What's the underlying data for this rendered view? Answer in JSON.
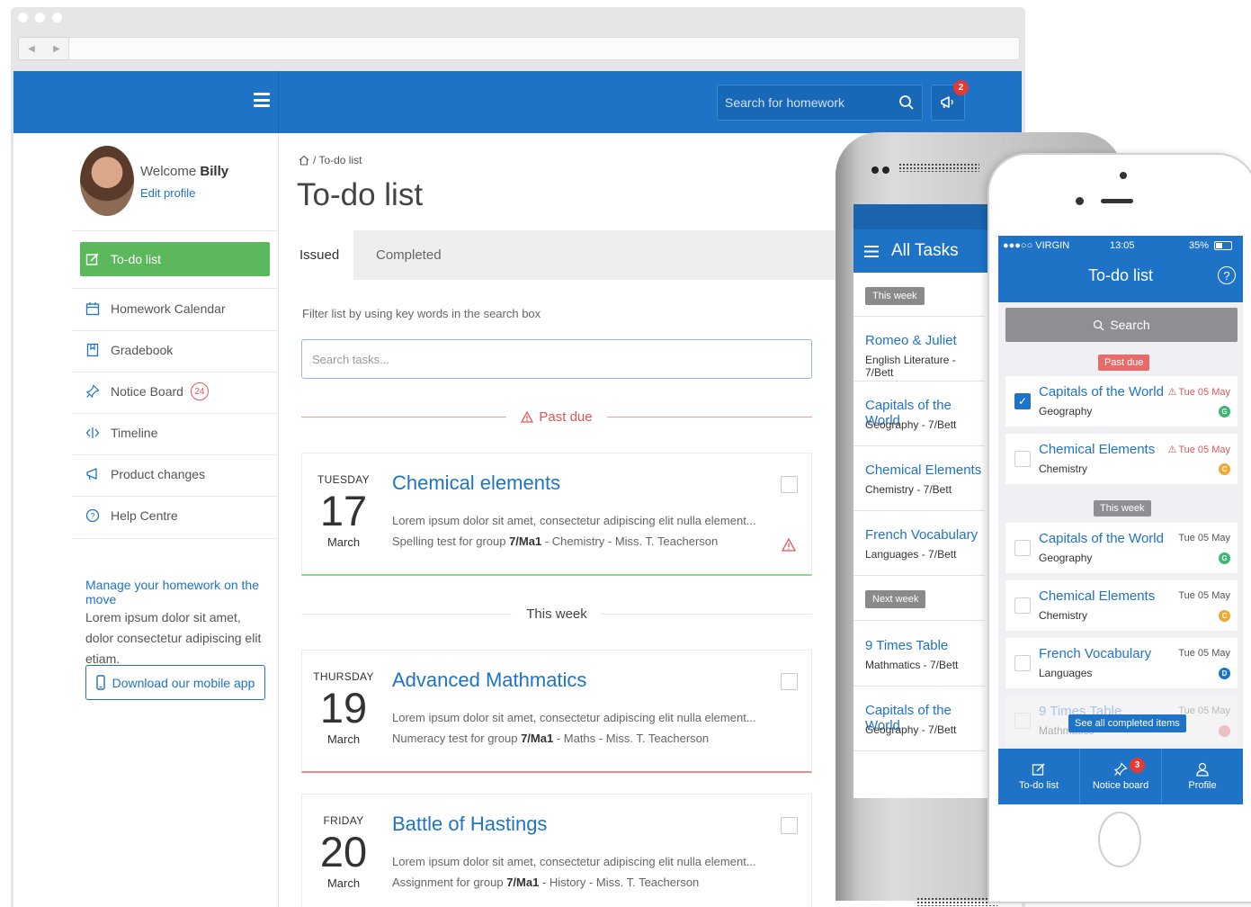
{
  "web": {
    "search_placeholder": "Search for homework",
    "notice_badge": "2",
    "user": {
      "welcome": "Welcome",
      "name": "Billy",
      "edit": "Edit profile"
    },
    "nav": [
      {
        "label": "To-do list"
      },
      {
        "label": "Homework Calendar"
      },
      {
        "label": "Gradebook"
      },
      {
        "label": "Notice Board",
        "count": "24"
      },
      {
        "label": "Timeline"
      },
      {
        "label": "Product changes"
      },
      {
        "label": "Help Centre"
      }
    ],
    "promo": {
      "title": "Manage your homework on the move",
      "text": "Lorem ipsum dolor sit amet, dolor consectetur adipiscing elit etiam.",
      "button": "Download our mobile app"
    },
    "breadcrumb": "/ To-do list",
    "page_title": "To-do list",
    "tabs": [
      "Issued",
      "Completed"
    ],
    "filter_hint": "Filter list by using key words in the search box",
    "task_search_placeholder": "Search tasks...",
    "sections": {
      "past_due": "Past due",
      "this_week": "This week"
    },
    "tasks": [
      {
        "day": "TUESDAY",
        "date": "17",
        "month": "March",
        "title": "Chemical elements",
        "desc": "Lorem ipsum dolor sit amet, consectetur adipiscing elit nulla element...",
        "meta_pre": "Spelling test for group ",
        "group": "7/Ma1",
        "meta_post": " - Chemistry - Miss. T. Teacherson"
      },
      {
        "day": "THURSDAY",
        "date": "19",
        "month": "March",
        "title": "Advanced Mathmatics",
        "desc": "Lorem ipsum dolor sit amet, consectetur adipiscing elit nulla element...",
        "meta_pre": "Numeracy test for group ",
        "group": "7/Ma1",
        "meta_post": " - Maths - Miss. T. Teacherson"
      },
      {
        "day": "FRIDAY",
        "date": "20",
        "month": "March",
        "title": "Battle of Hastings",
        "desc": "Lorem ipsum dolor sit amet, consectetur adipiscing elit nulla element...",
        "meta_pre": "Assignment for group ",
        "group": "7/Ma1",
        "meta_post": " - History - Miss. T. Teacherson"
      }
    ]
  },
  "android": {
    "title": "All Tasks",
    "pills": [
      "This week",
      "Next week"
    ],
    "items": [
      {
        "title": "Romeo & Juliet",
        "sub": "English Literature - 7/Bett"
      },
      {
        "title": "Capitals of the World",
        "sub": "Geography - 7/Bett"
      },
      {
        "title": "Chemical Elements",
        "sub": "Chemistry - 7/Bett"
      },
      {
        "title": "French Vocabulary",
        "sub": "Languages - 7/Bett"
      },
      {
        "title": "9 Times Table",
        "sub": "Mathmatics - 7/Bett"
      },
      {
        "title": "Capitals of the World",
        "sub": "Geography - 7/Bett"
      }
    ]
  },
  "iphone": {
    "carrier": "●●●○○ VIRGIN",
    "time": "13:05",
    "battery": "35%",
    "title": "To-do list",
    "help": "?",
    "search": "Search",
    "pills": {
      "past_due": "Past due",
      "this_week": "This week"
    },
    "rows": [
      {
        "title": "Capitals of the World",
        "sub": "Geography",
        "date": "Tue 05 May",
        "tag": "G"
      },
      {
        "title": "Chemical Elements",
        "sub": "Chemistry",
        "date": "Tue 05 May",
        "tag": "C"
      },
      {
        "title": "Capitals of the World",
        "sub": "Geography",
        "date": "Tue 05 May",
        "tag": "G"
      },
      {
        "title": "Chemical Elements",
        "sub": "Chemistry",
        "date": "Tue 05 May",
        "tag": "C"
      },
      {
        "title": "French Vocabulary",
        "sub": "Languages",
        "date": "Tue 05 May",
        "tag": "D"
      },
      {
        "title": "9 Times Table",
        "sub": "Mathmatics",
        "date": "Tue 05 May",
        "tag": ""
      }
    ],
    "see_completed": "See all completed items",
    "tabs": [
      {
        "label": "To-do list"
      },
      {
        "label": "Notice board",
        "badge": "3"
      },
      {
        "label": "Profile"
      }
    ]
  },
  "colors": {
    "brand": "#1f73c6",
    "success": "#5cb85c",
    "danger": "#e05555"
  }
}
